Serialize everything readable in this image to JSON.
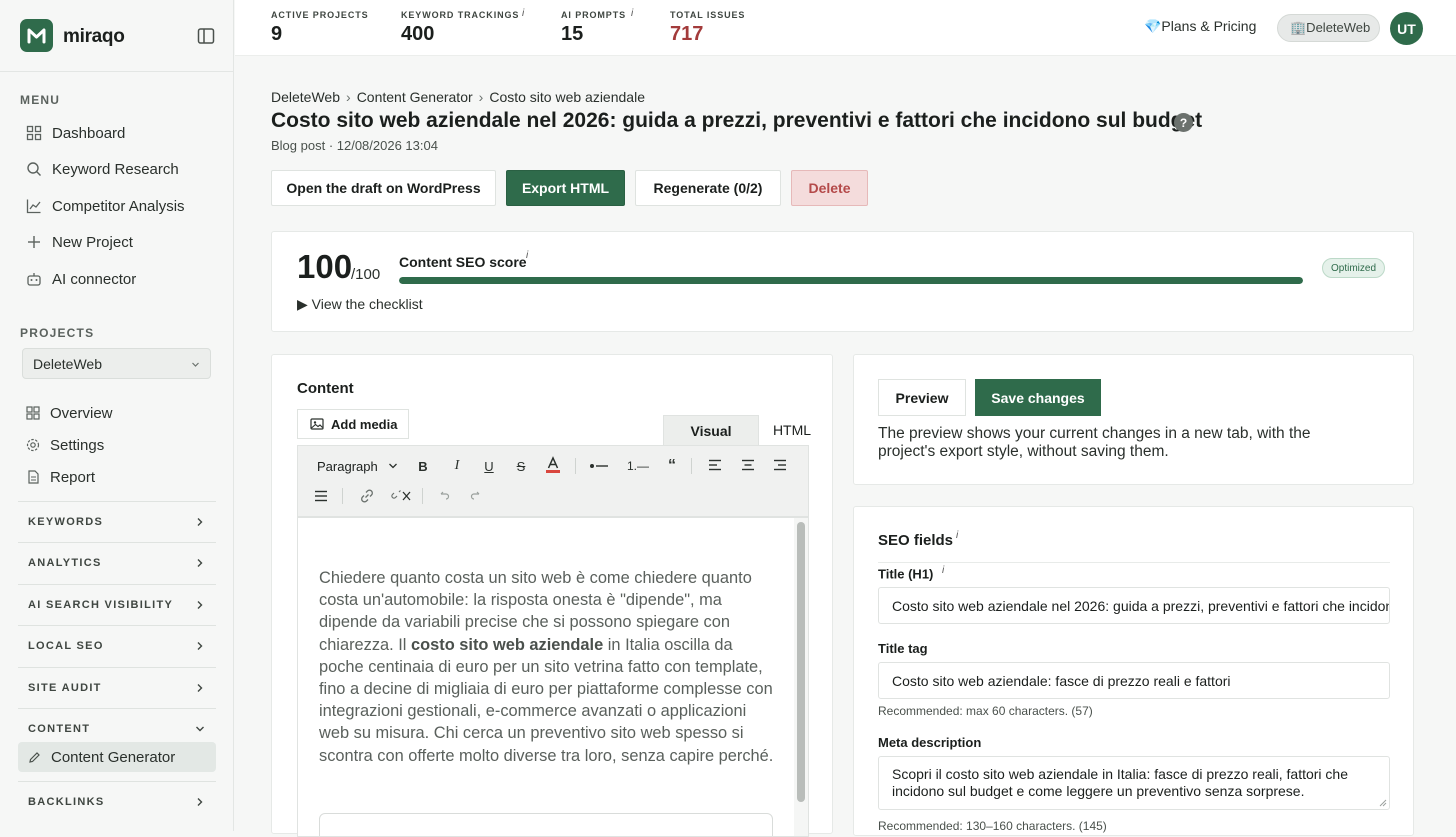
{
  "brand": {
    "name": "miraqo"
  },
  "sidebar": {
    "menu_label": "MENU",
    "menu_items": [
      {
        "label": "Dashboard",
        "icon": "grid-icon"
      },
      {
        "label": "Keyword Research",
        "icon": "search-icon"
      },
      {
        "label": "Competitor Analysis",
        "icon": "chart-line-icon"
      },
      {
        "label": "New Project",
        "icon": "plus-icon"
      },
      {
        "label": "AI connector",
        "icon": "robot-icon"
      }
    ],
    "projects_label": "PROJECTS",
    "project_selected": "DeleteWeb",
    "project_items": [
      {
        "label": "Overview",
        "icon": "grid-icon"
      },
      {
        "label": "Settings",
        "icon": "gear-icon"
      },
      {
        "label": "Report",
        "icon": "document-icon"
      }
    ],
    "sections": [
      "KEYWORDS",
      "ANALYTICS",
      "AI SEARCH VISIBILITY",
      "LOCAL SEO",
      "SITE AUDIT",
      "CONTENT",
      "BACKLINKS"
    ],
    "content_child": "Content Generator"
  },
  "topbar": {
    "stats": [
      {
        "label": "ACTIVE PROJECTS",
        "value": "9"
      },
      {
        "label": "KEYWORD TRACKINGS",
        "value": "400",
        "info": "i"
      },
      {
        "label": "AI PROMPTS",
        "value": "15",
        "info": "i"
      },
      {
        "label": "TOTAL ISSUES",
        "value": "717",
        "color": "#a33b3b"
      }
    ],
    "plans_label": "💎Plans & Pricing",
    "account_label": "🏢DeleteWeb",
    "avatar_initials": "UT"
  },
  "page": {
    "breadcrumb": [
      "DeleteWeb",
      "Content Generator",
      "Costo sito web aziendale"
    ],
    "breadcrumb_sep": "›",
    "title": "Costo sito web aziendale nel 2026: guida a prezzi, preventivi e fattori che incidono sul budget",
    "help": "?",
    "meta": "Blog post · 12/08/2026 13:04",
    "buttons": {
      "open_wp": "Open the draft on WordPress",
      "export": "Export HTML",
      "regenerate": "Regenerate (0/2)",
      "delete": "Delete"
    }
  },
  "score": {
    "value": "100",
    "max": "/100",
    "fraction": 1.0,
    "label": "Content SEO score",
    "info": "i",
    "badge": "Optimized",
    "checklist": "▶ View the checklist"
  },
  "editor": {
    "title": "Content",
    "add_media": "Add media",
    "tabs": {
      "visual": "Visual",
      "html": "HTML"
    },
    "block_format": "Paragraph",
    "toolbar_icons": [
      "bold-icon",
      "italic-icon",
      "underline-icon",
      "strikethrough-icon",
      "text-color-icon",
      "bullet-list-icon",
      "numbered-list-icon",
      "quote-icon",
      "align-left-icon",
      "align-center-icon",
      "align-right-icon",
      "justify-icon",
      "link-icon",
      "unlink-icon",
      "undo-icon",
      "redo-icon"
    ],
    "text_before": "Chiedere quanto costa un sito web è come chiedere quanto costa un'automobile: la risposta onesta è \"dipende\", ma dipende da variabili precise che si possono spiegare con chiarezza. Il ",
    "text_bold": "costo sito web aziendale",
    "text_after": " in Italia oscilla da poche centinaia di euro per un sito vetrina fatto con template, fino a decine di migliaia di euro per piattaforme complesse con integrazioni gestionali, e-commerce avanzati o applicazioni web su misura. Chi cerca un preventivo sito web spesso si scontra con offerte molto diverse tra loro, senza capire perché."
  },
  "preview": {
    "preview_btn": "Preview",
    "save_btn": "Save changes",
    "note": "The preview shows your current changes in a new tab, with the project's export style, without saving them."
  },
  "seo": {
    "title": "SEO fields",
    "info": "i",
    "h1_label": "Title (H1)",
    "h1_info": "i",
    "h1_value": "Costo sito web aziendale nel 2026: guida a prezzi, preventivi e fattori che incidono sul budget",
    "title_tag_label": "Title tag",
    "title_tag_value": "Costo sito web aziendale: fasce di prezzo reali e fattori",
    "title_tag_help": "Recommended: max 60 characters. (57)",
    "meta_label": "Meta description",
    "meta_value": "Scopri il costo sito web aziendale in Italia: fasce di prezzo reali, fattori che incidono sul budget e come leggere un preventivo senza sorprese.",
    "meta_help": "Recommended: 130–160 characters. (145)"
  }
}
